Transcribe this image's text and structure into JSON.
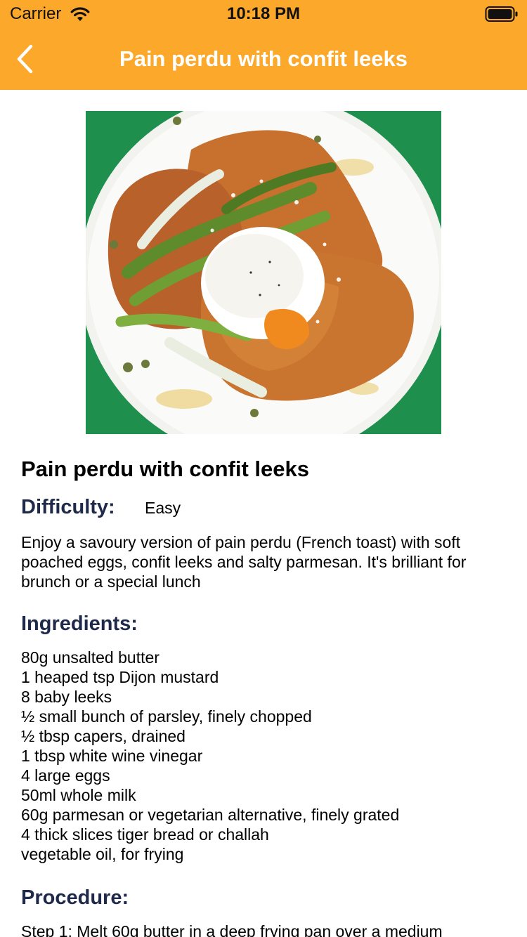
{
  "status_bar": {
    "carrier": "Carrier",
    "time": "10:18 PM",
    "wifi_icon": "wifi-icon",
    "battery_icon": "battery-icon"
  },
  "nav": {
    "back_icon": "chevron-left-icon",
    "title": "Pain perdu with confit leeks"
  },
  "theme": {
    "nav_background": "#FBA82B",
    "heading_color": "#1F2A4A"
  },
  "recipe": {
    "image_label": "dish-photo",
    "title": "Pain perdu with confit leeks",
    "difficulty_label": "Difficulty:",
    "difficulty_value": "Easy",
    "description": "Enjoy a savoury version of pain perdu (French toast) with soft poached eggs, confit leeks and salty parmesan. It's brilliant for brunch or a special lunch",
    "ingredients_heading": "Ingredients:",
    "ingredients": [
      "80g unsalted butter",
      "1 heaped tsp Dijon mustard",
      "8 baby leeks",
      "½ small bunch of parsley, finely chopped",
      "½ tbsp capers, drained",
      "1 tbsp white wine vinegar",
      "4 large eggs",
      "50ml whole milk",
      "60g parmesan or vegetarian alternative, finely grated",
      "4 thick slices tiger bread or challah",
      "vegetable oil, for frying"
    ],
    "procedure_heading": "Procedure:",
    "procedure_steps": [
      "Step 1: Melt 60g butter in a deep frying pan over a medium"
    ]
  }
}
